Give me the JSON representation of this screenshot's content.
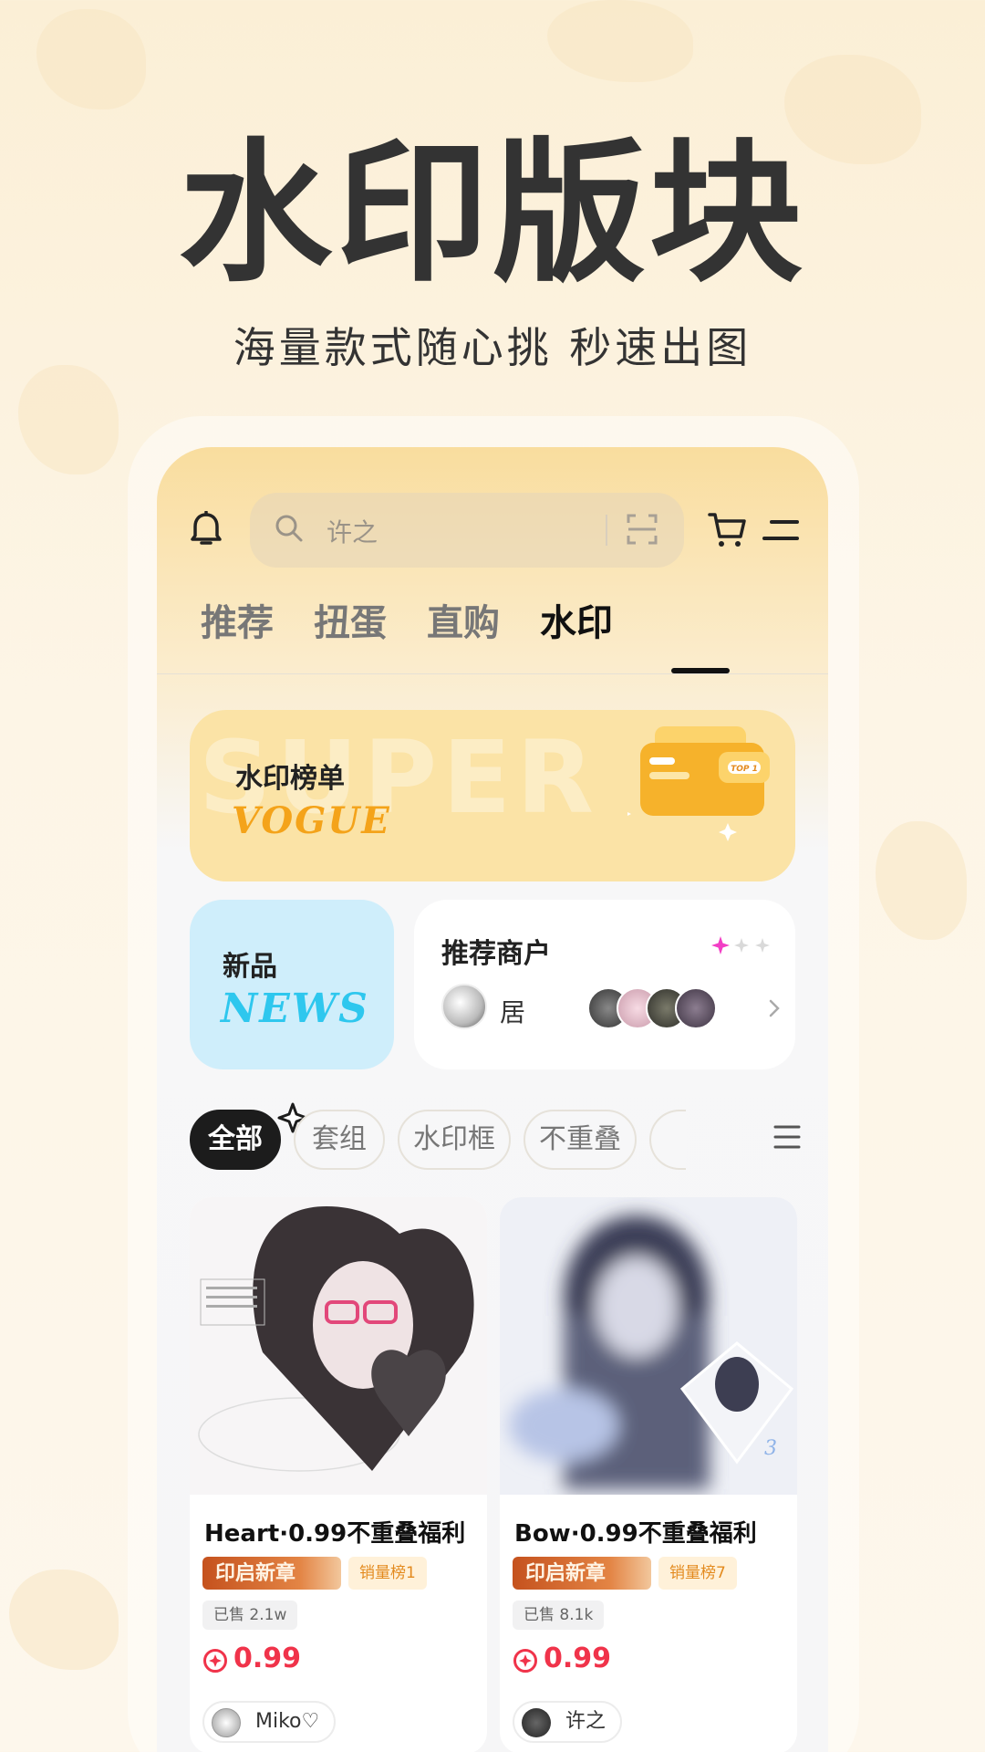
{
  "hero": {
    "title": "水印版块",
    "subtitle": "海量款式随心挑 秒速出图"
  },
  "search": {
    "placeholder": "许之"
  },
  "icons": {
    "bell": "bell-icon",
    "search": "search-icon",
    "scan": "scan-icon",
    "cart": "cart-icon",
    "menu": "menu-icon"
  },
  "tabs": [
    {
      "label": "推荐",
      "active": false
    },
    {
      "label": "扭蛋",
      "active": false
    },
    {
      "label": "直购",
      "active": false
    },
    {
      "label": "水印",
      "active": true
    }
  ],
  "rank_banner": {
    "title": "水印榜单",
    "deco": "VOGUE",
    "badge": "TOP 1",
    "ghost": "SUPER"
  },
  "news_card": {
    "title": "新品",
    "deco": "NEWS"
  },
  "merchant_card": {
    "title": "推荐商户",
    "merchant_name": "居"
  },
  "filters": [
    {
      "label": "全部",
      "active": true
    },
    {
      "label": "套组",
      "active": false
    },
    {
      "label": "水印框",
      "active": false
    },
    {
      "label": "不重叠",
      "active": false
    }
  ],
  "products": [
    {
      "title": "Heart·0.99不重叠福利",
      "brand_tag": "印启新章",
      "rank_tag": "销量榜1",
      "sold": "已售 2.1w",
      "price": "0.99",
      "seller": "Miko♡"
    },
    {
      "title": "Bow·0.99不重叠福利",
      "brand_tag": "印启新章",
      "rank_tag": "销量榜7",
      "sold": "已售 8.1k",
      "price": "0.99",
      "seller": "许之"
    }
  ],
  "colors": {
    "accent_price": "#f0334a",
    "rank_orange": "#f4a31a",
    "news_blue": "#2ec7ee",
    "active_chip": "#1c1c1c"
  }
}
